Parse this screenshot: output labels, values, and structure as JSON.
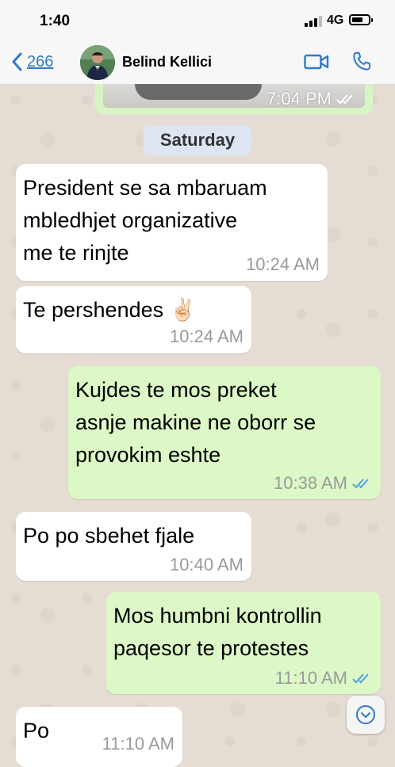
{
  "status_bar": {
    "time": "1:40",
    "network": "4G"
  },
  "header": {
    "back_count": "266",
    "contact_name": "Belind Kellici",
    "icons": [
      "chevron-left-icon",
      "avatar",
      "video-call-icon",
      "phone-call-icon"
    ]
  },
  "media_message": {
    "time": "7:04 PM",
    "status": "read"
  },
  "date_separator": "Saturday",
  "messages": [
    {
      "direction": "incoming",
      "text": "President se sa mbaruam\nmbledhjet organizative\nme te rinjte",
      "time": "10:24 AM"
    },
    {
      "direction": "incoming",
      "text": "Te pershendes ✌🏻",
      "time": "10:24 AM"
    },
    {
      "direction": "outgoing",
      "text": "Kujdes te mos preket\nasnje makine ne oborr se\nprovokim eshte",
      "time": "10:38 AM",
      "status": "read"
    },
    {
      "direction": "incoming",
      "text": "Po po sbehet fjale",
      "time": "10:40 AM"
    },
    {
      "direction": "outgoing",
      "text": "Mos humbni kontrollin\npaqesor te protestes",
      "time": "11:10 AM",
      "status": "read"
    },
    {
      "direction": "incoming",
      "text": "Po",
      "time": "11:10 AM"
    }
  ],
  "colors": {
    "accent": "#2f79c9",
    "incoming_bubble": "#ffffff",
    "outgoing_bubble": "#dcf8c6",
    "read_ticks": "#4fa3e0",
    "chat_background": "#e5ddd3"
  },
  "battery_level": 0.7
}
